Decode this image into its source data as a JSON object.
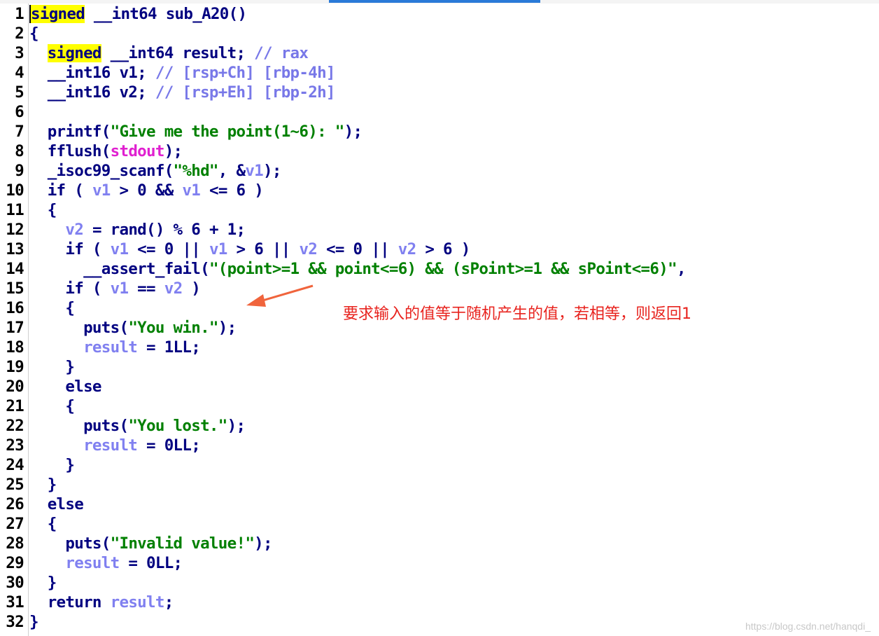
{
  "editor": {
    "lines": [
      {
        "n": "1",
        "segs": [
          [
            "cursor",
            "signed"
          ],
          [
            "kw",
            " __int64 sub_A20()"
          ]
        ]
      },
      {
        "n": "2",
        "segs": [
          [
            "kw",
            "{"
          ]
        ]
      },
      {
        "n": "3",
        "segs": [
          [
            "kw",
            "  "
          ],
          [
            "hl",
            "signed"
          ],
          [
            "kw",
            " __int64 result; "
          ],
          [
            "cmt",
            "// rax"
          ]
        ]
      },
      {
        "n": "4",
        "segs": [
          [
            "kw",
            "  __int16 v1; "
          ],
          [
            "cmt",
            "// [rsp+Ch] [rbp-4h]"
          ]
        ]
      },
      {
        "n": "5",
        "segs": [
          [
            "kw",
            "  __int16 v2; "
          ],
          [
            "cmt",
            "// [rsp+Eh] [rbp-2h]"
          ]
        ]
      },
      {
        "n": "6",
        "segs": []
      },
      {
        "n": "7",
        "segs": [
          [
            "kw",
            "  printf("
          ],
          [
            "str",
            "\"Give me the point(1~6): \""
          ],
          [
            "kw",
            ");"
          ]
        ]
      },
      {
        "n": "8",
        "segs": [
          [
            "kw",
            "  fflush("
          ],
          [
            "glb",
            "stdout"
          ],
          [
            "kw",
            ");"
          ]
        ]
      },
      {
        "n": "9",
        "segs": [
          [
            "kw",
            "  _isoc99_scanf("
          ],
          [
            "str",
            "\"%hd\""
          ],
          [
            "kw",
            ", &"
          ],
          [
            "var",
            "v1"
          ],
          [
            "kw",
            ");"
          ]
        ]
      },
      {
        "n": "10",
        "segs": [
          [
            "kw",
            "  if ( "
          ],
          [
            "var",
            "v1"
          ],
          [
            "kw",
            " > 0 && "
          ],
          [
            "var",
            "v1"
          ],
          [
            "kw",
            " <= 6 )"
          ]
        ]
      },
      {
        "n": "11",
        "segs": [
          [
            "kw",
            "  {"
          ]
        ]
      },
      {
        "n": "12",
        "segs": [
          [
            "kw",
            "    "
          ],
          [
            "var",
            "v2"
          ],
          [
            "kw",
            " = rand() % 6 + 1;"
          ]
        ]
      },
      {
        "n": "13",
        "segs": [
          [
            "kw",
            "    if ( "
          ],
          [
            "var",
            "v1"
          ],
          [
            "kw",
            " <= 0 || "
          ],
          [
            "var",
            "v1"
          ],
          [
            "kw",
            " > 6 || "
          ],
          [
            "var",
            "v2"
          ],
          [
            "kw",
            " <= 0 || "
          ],
          [
            "var",
            "v2"
          ],
          [
            "kw",
            " > 6 )"
          ]
        ]
      },
      {
        "n": "14",
        "segs": [
          [
            "kw",
            "      __assert_fail("
          ],
          [
            "str",
            "\"(point>=1 && point<=6) && (sPoint>=1 && sPoint<=6)\""
          ],
          [
            "kw",
            ","
          ]
        ]
      },
      {
        "n": "15",
        "segs": [
          [
            "kw",
            "    if ( "
          ],
          [
            "var",
            "v1"
          ],
          [
            "kw",
            " == "
          ],
          [
            "var",
            "v2"
          ],
          [
            "kw",
            " )"
          ]
        ]
      },
      {
        "n": "16",
        "segs": [
          [
            "kw",
            "    {"
          ]
        ]
      },
      {
        "n": "17",
        "segs": [
          [
            "kw",
            "      puts("
          ],
          [
            "str",
            "\"You win.\""
          ],
          [
            "kw",
            ");"
          ]
        ]
      },
      {
        "n": "18",
        "segs": [
          [
            "kw",
            "      "
          ],
          [
            "var",
            "result"
          ],
          [
            "kw",
            " = 1LL;"
          ]
        ]
      },
      {
        "n": "19",
        "segs": [
          [
            "kw",
            "    }"
          ]
        ]
      },
      {
        "n": "20",
        "segs": [
          [
            "kw",
            "    else"
          ]
        ]
      },
      {
        "n": "21",
        "segs": [
          [
            "kw",
            "    {"
          ]
        ]
      },
      {
        "n": "22",
        "segs": [
          [
            "kw",
            "      puts("
          ],
          [
            "str",
            "\"You lost.\""
          ],
          [
            "kw",
            ");"
          ]
        ]
      },
      {
        "n": "23",
        "segs": [
          [
            "kw",
            "      "
          ],
          [
            "var",
            "result"
          ],
          [
            "kw",
            " = 0LL;"
          ]
        ]
      },
      {
        "n": "24",
        "segs": [
          [
            "kw",
            "    }"
          ]
        ]
      },
      {
        "n": "25",
        "segs": [
          [
            "kw",
            "  }"
          ]
        ]
      },
      {
        "n": "26",
        "segs": [
          [
            "kw",
            "  else"
          ]
        ]
      },
      {
        "n": "27",
        "segs": [
          [
            "kw",
            "  {"
          ]
        ]
      },
      {
        "n": "28",
        "segs": [
          [
            "kw",
            "    puts("
          ],
          [
            "str",
            "\"Invalid value!\""
          ],
          [
            "kw",
            ");"
          ]
        ]
      },
      {
        "n": "29",
        "segs": [
          [
            "kw",
            "    "
          ],
          [
            "var",
            "result"
          ],
          [
            "kw",
            " = 0LL;"
          ]
        ]
      },
      {
        "n": "30",
        "segs": [
          [
            "kw",
            "  }"
          ]
        ]
      },
      {
        "n": "31",
        "segs": [
          [
            "kw",
            "  return "
          ],
          [
            "var",
            "result"
          ],
          [
            "kw",
            ";"
          ]
        ]
      },
      {
        "n": "32",
        "segs": [
          [
            "kw",
            "}"
          ]
        ]
      }
    ]
  },
  "annotation": {
    "text": "要求输入的值等于随机产生的值，若相等，则返回1",
    "color": "#e8231e"
  },
  "watermark": "https://blog.csdn.net/hanqdi_",
  "colors": {
    "keyword": "#000080",
    "string": "#008000",
    "variable": "#8080f0",
    "global": "#e020d0",
    "highlight": "#ffff00"
  }
}
